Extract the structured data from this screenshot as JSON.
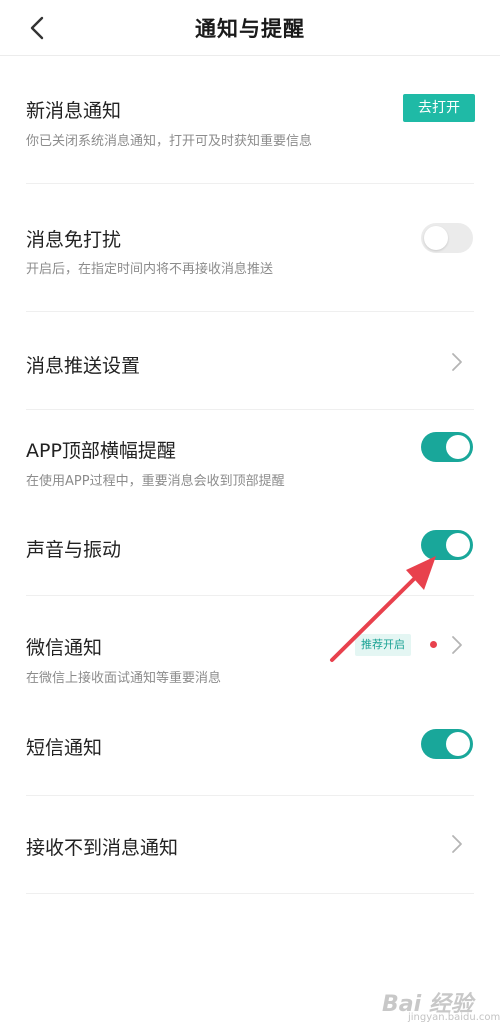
{
  "header": {
    "title": "通知与提醒"
  },
  "items": {
    "new_msg": {
      "title": "新消息通知",
      "sub": "你已关闭系统消息通知，打开可及时获知重要信息",
      "button": "去打开"
    },
    "dnd": {
      "title": "消息免打扰",
      "sub": "开启后，在指定时间内将不再接收消息推送",
      "state": "off"
    },
    "push": {
      "title": "消息推送设置"
    },
    "banner": {
      "title": "APP顶部横幅提醒",
      "sub": "在使用APP过程中，重要消息会收到顶部提醒",
      "state": "on"
    },
    "sound": {
      "title": "声音与振动",
      "state": "on"
    },
    "wechat": {
      "title": "微信通知",
      "sub": "在微信上接收面试通知等重要消息",
      "badge": "推荐开启"
    },
    "sms": {
      "title": "短信通知",
      "state": "on"
    },
    "not_received": {
      "title": "接收不到消息通知"
    }
  },
  "watermark": {
    "text": "Bai 经验",
    "sub": "jingyan.baidu.com"
  },
  "colors": {
    "accent": "#19a79a",
    "button": "#1fbaa6",
    "annotation": "#e8414d"
  }
}
